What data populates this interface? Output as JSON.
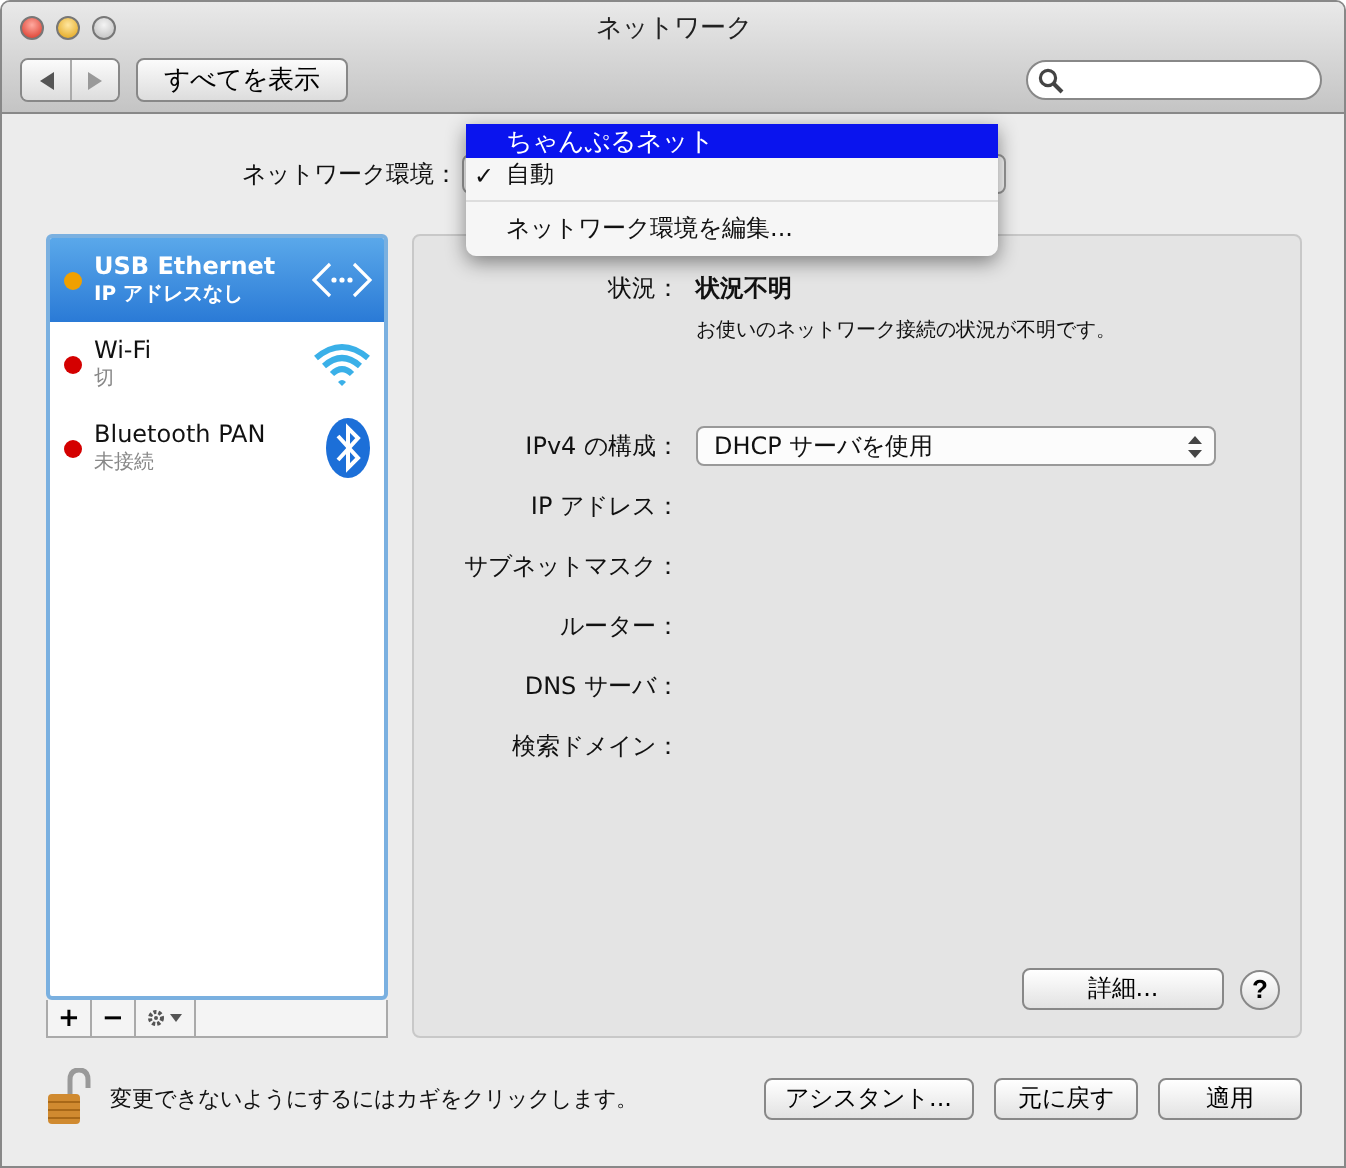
{
  "window": {
    "title": "ネットワーク"
  },
  "toolbar": {
    "show_all": "すべてを表示"
  },
  "location": {
    "label": "ネットワーク環境：",
    "check_mark": "✓",
    "menu": [
      {
        "kind": "item",
        "label": "ちゃんぷるネット",
        "selected": true,
        "checked": false
      },
      {
        "kind": "item",
        "label": "自動",
        "selected": false,
        "checked": true
      },
      {
        "kind": "separator"
      },
      {
        "kind": "item",
        "label": "ネットワーク環境を編集...",
        "selected": false,
        "checked": false
      }
    ]
  },
  "services": [
    {
      "name": "USB Ethernet",
      "status": "IP アドレスなし",
      "color": "#f0a000",
      "kind": "ethernet",
      "selected": true
    },
    {
      "name": "Wi-Fi",
      "status": "切",
      "color": "#d40000",
      "kind": "wifi",
      "selected": false
    },
    {
      "name": "Bluetooth PAN",
      "status": "未接続",
      "color": "#d40000",
      "kind": "bluetooth",
      "selected": false
    }
  ],
  "detail": {
    "status_label": "状況：",
    "status_value": "状況不明",
    "status_description": "お使いのネットワーク接続の状況が不明です。",
    "fields": [
      {
        "kind": "select",
        "label": "IPv4 の構成：",
        "value": "DHCP サーバを使用"
      },
      {
        "kind": "text",
        "label": "IP アドレス："
      },
      {
        "kind": "text",
        "label": "サブネットマスク："
      },
      {
        "kind": "text",
        "label": "ルーター："
      },
      {
        "kind": "text",
        "label": "DNS サーバ："
      },
      {
        "kind": "text",
        "label": "検索ドメイン："
      }
    ],
    "advanced": "詳細...",
    "help": "?"
  },
  "list_buttons": [
    "+",
    "−"
  ],
  "footer": {
    "lock_text": "変更できないようにするにはカギをクリックします。",
    "buttons": [
      "アシスタント...",
      "元に戻す",
      "適用"
    ]
  }
}
